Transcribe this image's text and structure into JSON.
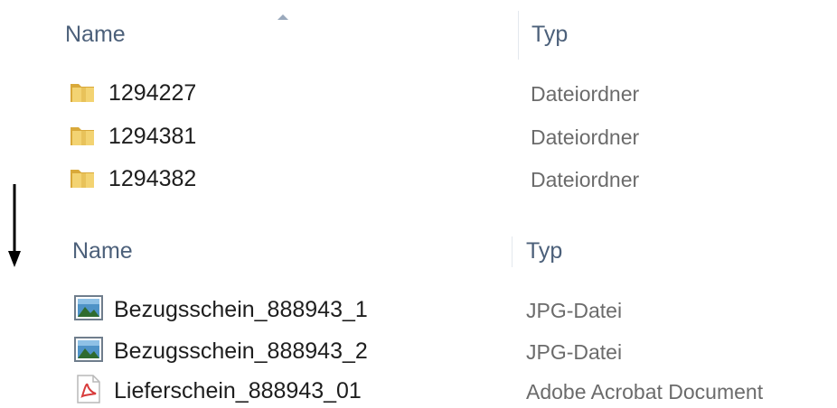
{
  "top_pane": {
    "columns": {
      "name": "Name",
      "type": "Typ"
    },
    "sort": "ascending",
    "rows": [
      {
        "name": "1294227",
        "type": "Dateiordner",
        "icon": "folder-icon"
      },
      {
        "name": "1294381",
        "type": "Dateiordner",
        "icon": "folder-icon"
      },
      {
        "name": "1294382",
        "type": "Dateiordner",
        "icon": "folder-icon"
      }
    ]
  },
  "arrow": {
    "icon": "down-arrow-icon"
  },
  "bottom_pane": {
    "columns": {
      "name": "Name",
      "type": "Typ"
    },
    "rows": [
      {
        "name": "Bezugsschein_888943_1",
        "type": "JPG-Datei",
        "icon": "image-file-icon"
      },
      {
        "name": "Bezugsschein_888943_2",
        "type": "JPG-Datei",
        "icon": "image-file-icon"
      },
      {
        "name": "Lieferschein_888943_01",
        "type": "Adobe Acrobat Document",
        "icon": "pdf-file-icon"
      }
    ]
  },
  "colors": {
    "header_text": "#4c607a",
    "type_text": "#6b6b6b",
    "folder_yellow": "#e8c25a",
    "pdf_red": "#d83b3b"
  }
}
